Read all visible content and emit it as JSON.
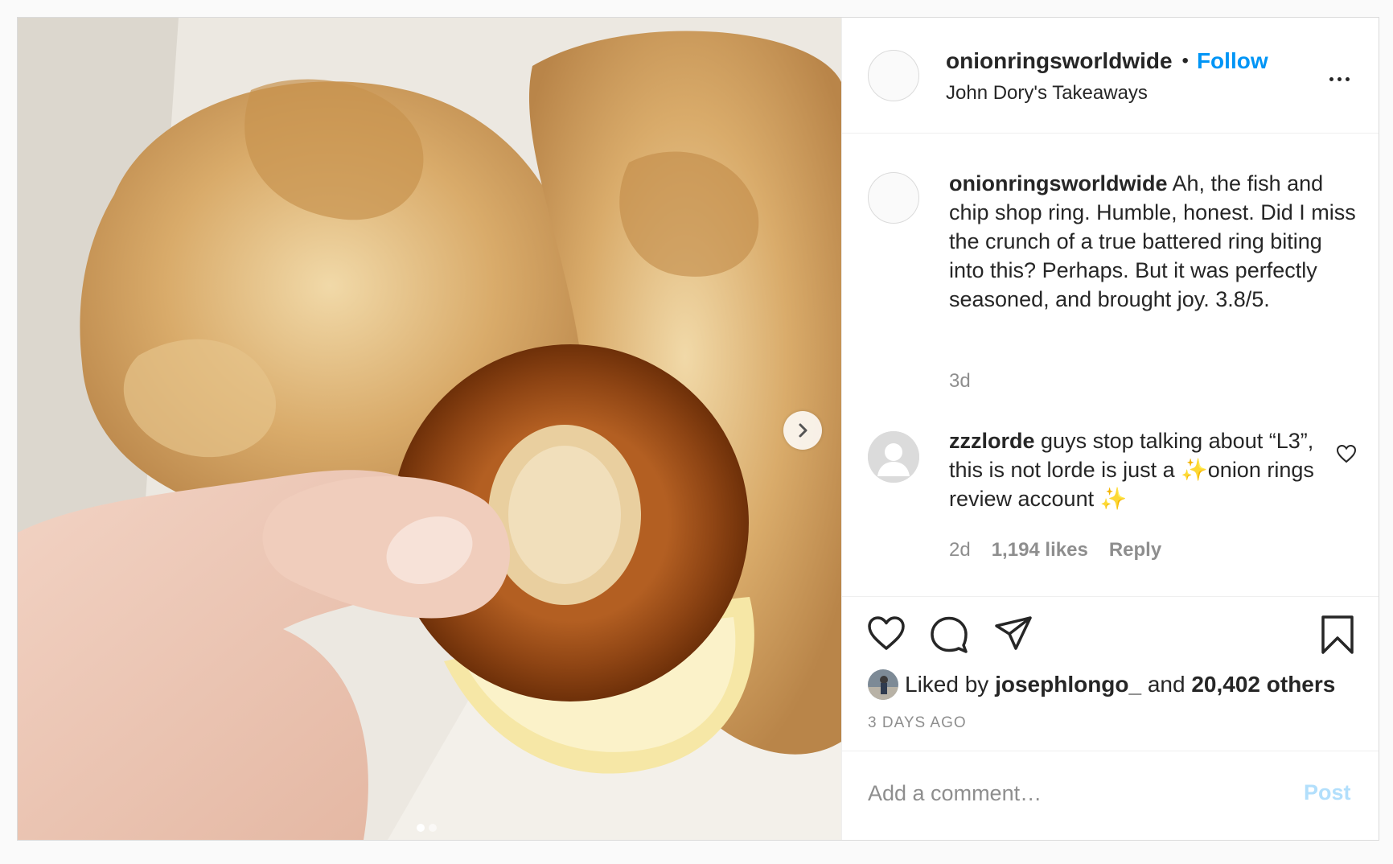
{
  "post": {
    "image_alt": "Hand holding an onion ring over battered fish with a lemon wedge",
    "slides_count": 2,
    "active_slide": 1
  },
  "header": {
    "username": "onionringsworldwide",
    "bullet": "•",
    "follow_label": "Follow",
    "location": "John Dory's Takeaways"
  },
  "caption": {
    "username": "onionringsworldwide",
    "text": "Ah, the fish and chip shop ring. Humble, honest. Did I miss the crunch of a true battered ring biting into this? Perhaps. But it was perfectly seasoned, and brought joy. 3.8/5.",
    "time": "3d"
  },
  "comment": {
    "username": "zzzlorde",
    "text_main": "guys stop talking about “L3”, this is not lorde is just a",
    "sparkle": "✨",
    "text_tail": "onion rings review account",
    "time": "2d",
    "likes": "1,194 likes",
    "reply_label": "Reply"
  },
  "engagement": {
    "liked_by_prefix": "Liked by",
    "liked_by_user": "josephlongo_",
    "and": "and",
    "others": "20,402 others",
    "date": "3 DAYS AGO"
  },
  "add_comment": {
    "placeholder": "Add a comment…",
    "post_label": "Post"
  },
  "colors": {
    "link_blue": "#0095f6",
    "post_disabled": "#b2dffc",
    "secondary_text": "#8e8e8e",
    "border": "#dbdbdb"
  },
  "icons": [
    "chevron-right-icon",
    "more-icon",
    "heart-icon",
    "comment-icon",
    "share-icon",
    "bookmark-icon",
    "small-heart-icon"
  ]
}
